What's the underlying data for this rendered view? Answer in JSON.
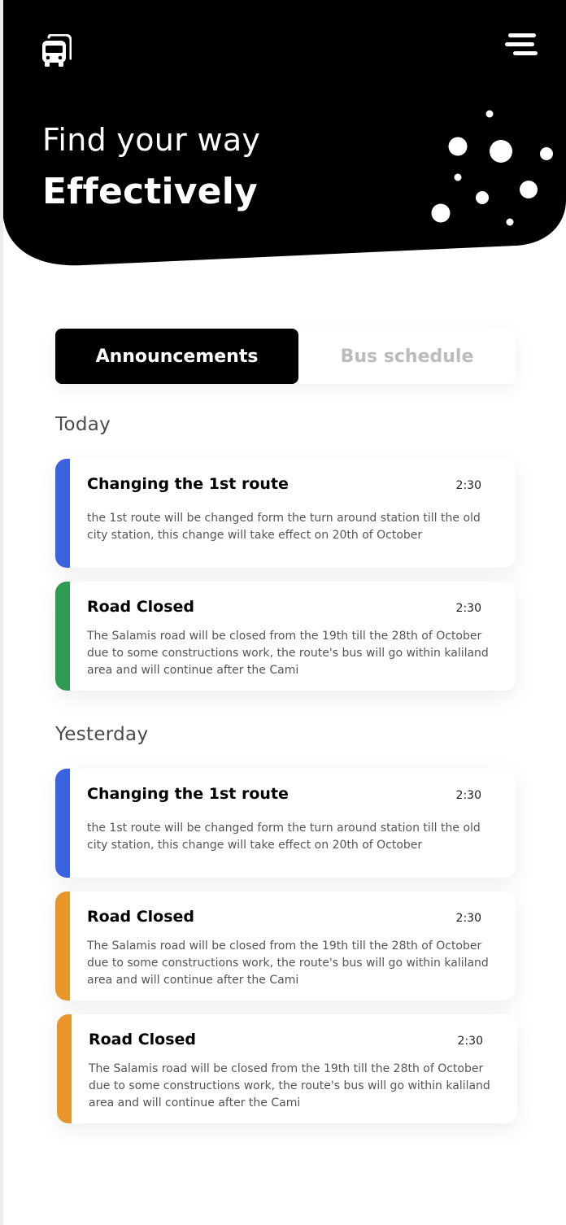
{
  "header": {
    "headline_line1": "Find your way",
    "headline_line2": "Effectively",
    "logo_icon": "bus-icon",
    "menu_icon": "hamburger-menu-icon",
    "background_color": "#000000"
  },
  "tabs": [
    {
      "label": "Announcements",
      "active": true
    },
    {
      "label": "Bus schedule",
      "active": false
    }
  ],
  "sections": [
    {
      "title": "Today",
      "items": [
        {
          "title": "Changing the 1st route",
          "time": "2:30",
          "body": "the 1st route will be changed form the turn around station till the old city station, this change will take effect on 20th of October",
          "accent": "#3b63e0"
        },
        {
          "title": "Road Closed",
          "time": "2:30",
          "body": "The Salamis road will be closed from the 19th till the 28th of October due to some constructions work, the route's bus will go within kaliland area and will continue after the Cami",
          "accent": "#2e9a52"
        }
      ]
    },
    {
      "title": "Yesterday",
      "items": [
        {
          "title": "Changing the 1st route",
          "time": "2:30",
          "body": "the 1st route will be changed form the turn around station till the old city station, this change will take effect on 20th of October",
          "accent": "#3b63e0"
        },
        {
          "title": "Road Closed",
          "time": "2:30",
          "body": "The Salamis road will be closed from the 19th till the 28th of October due to some constructions work, the route's bus will go within kaliland area and will continue after the Cami",
          "accent": "#e8952a"
        },
        {
          "title": "Road Closed",
          "time": "2:30",
          "body": "The Salamis road will be closed from the 19th till the 28th of October due to some constructions work, the route's bus will go within kaliland area and will continue after the Cami",
          "accent": "#e8952a"
        }
      ]
    }
  ]
}
